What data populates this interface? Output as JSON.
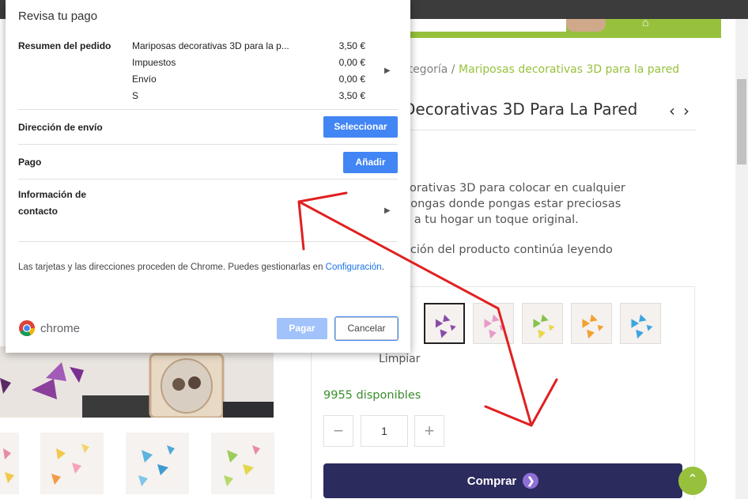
{
  "dialog": {
    "title": "Revisa tu pago",
    "summary_label": "Resumen del pedido",
    "items": [
      {
        "name": "Mariposas decorativas 3D para la p...",
        "price": "3,50 €"
      },
      {
        "name": "Impuestos",
        "price": "0,00 €"
      },
      {
        "name": "Envío",
        "price": "0,00 €"
      },
      {
        "name": "S",
        "price": "3,50 €"
      }
    ],
    "shipping_label": "Dirección de envío",
    "shipping_button": "Seleccionar",
    "payment_label": "Pago",
    "payment_button": "Añadir",
    "contact_label_1": "Información de",
    "contact_label_2": "contacto",
    "footer_text": "Las tarjetas y las direcciones proceden de Chrome. Puedes gestionarlas en ",
    "footer_link": "Configuración",
    "footer_end": ".",
    "brand": "chrome",
    "pay_button": "Pagar",
    "cancel_button": "Cancelar"
  },
  "product": {
    "breadcrumb_prefix": "ategoría / ",
    "breadcrumb_current": "Mariposas decorativas 3D para la pared",
    "title": "Decorativas 3D Para La Pared",
    "description": "corativas 3D para colocar en cualquier\npongas donde pongas estar preciosas\nn a tu hogar un toque original.",
    "description_more": "ación del producto continúa leyendo",
    "clear_label": "Limpiar",
    "stock": "9955 disponibles",
    "quantity": "1",
    "minus": "−",
    "plus": "+",
    "buy_button": "Comprar",
    "swatch_colors": [
      "#8a4aa8",
      "#e79bc7",
      "#86c24a",
      "#f2a12f",
      "#3ea6df"
    ]
  },
  "colors": {
    "accent_green": "#97c13c",
    "buy_button": "#2b2b5e",
    "chrome_blue": "#4285f4",
    "annotation_red": "#e02020"
  }
}
